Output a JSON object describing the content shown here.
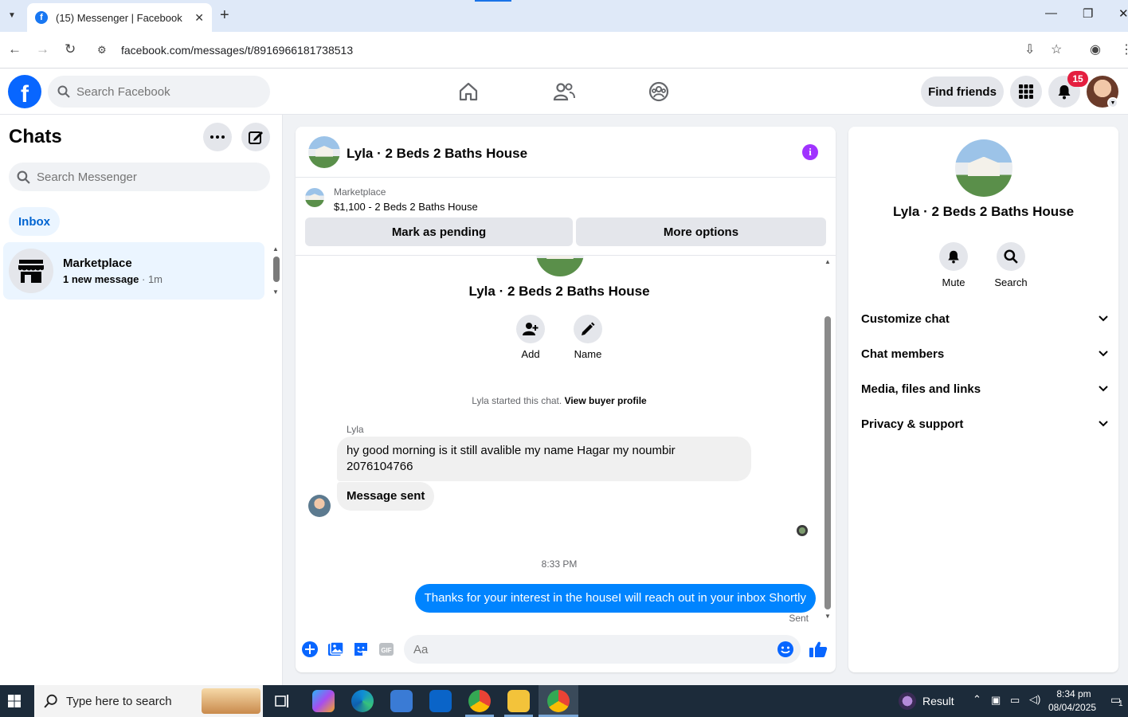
{
  "browser": {
    "tab_title": "(15) Messenger | Facebook",
    "url": "facebook.com/messages/t/8916966181738513"
  },
  "fb_header": {
    "search_placeholder": "Search Facebook",
    "find_friends_label": "Find friends",
    "notification_count": "15"
  },
  "sidebar": {
    "title": "Chats",
    "search_placeholder": "Search Messenger",
    "filter_label": "Inbox",
    "chats": [
      {
        "name": "Marketplace",
        "preview": "1 new message",
        "time": "· 1m"
      }
    ]
  },
  "conversation": {
    "title": "Lyla · 2 Beds 2 Baths House",
    "listing": {
      "label": "Marketplace",
      "title": "$1,100 - 2 Beds 2 Baths House"
    },
    "buttons": {
      "mark_pending": "Mark as pending",
      "more_options": "More options"
    },
    "intro_name": "Lyla · 2 Beds 2 Baths House",
    "actions": {
      "add": "Add",
      "name": "Name"
    },
    "started_text": "Lyla started this chat.",
    "view_profile": "View buyer profile",
    "sender": "Lyla",
    "messages": [
      {
        "direction": "in",
        "text": "hy good morning is it still avalible my name Hagar my noumbir 2076104766"
      },
      {
        "direction": "in",
        "text": "Message sent"
      },
      {
        "direction": "out",
        "text": "Thanks for your interest in the houseI will reach out in your inbox Shortly"
      }
    ],
    "timestamp": "8:33 PM",
    "sent_status": "Sent",
    "composer_placeholder": "Aa"
  },
  "details": {
    "name": "Lyla · 2 Beds 2 Baths House",
    "mute_label": "Mute",
    "search_label": "Search",
    "sections": [
      "Customize chat",
      "Chat members",
      "Media, files and links",
      "Privacy & support"
    ]
  },
  "taskbar": {
    "search_placeholder": "Type here to search",
    "weather_label": "Result",
    "time": "8:34 pm",
    "date": "08/04/2025",
    "notification_count": "1"
  }
}
